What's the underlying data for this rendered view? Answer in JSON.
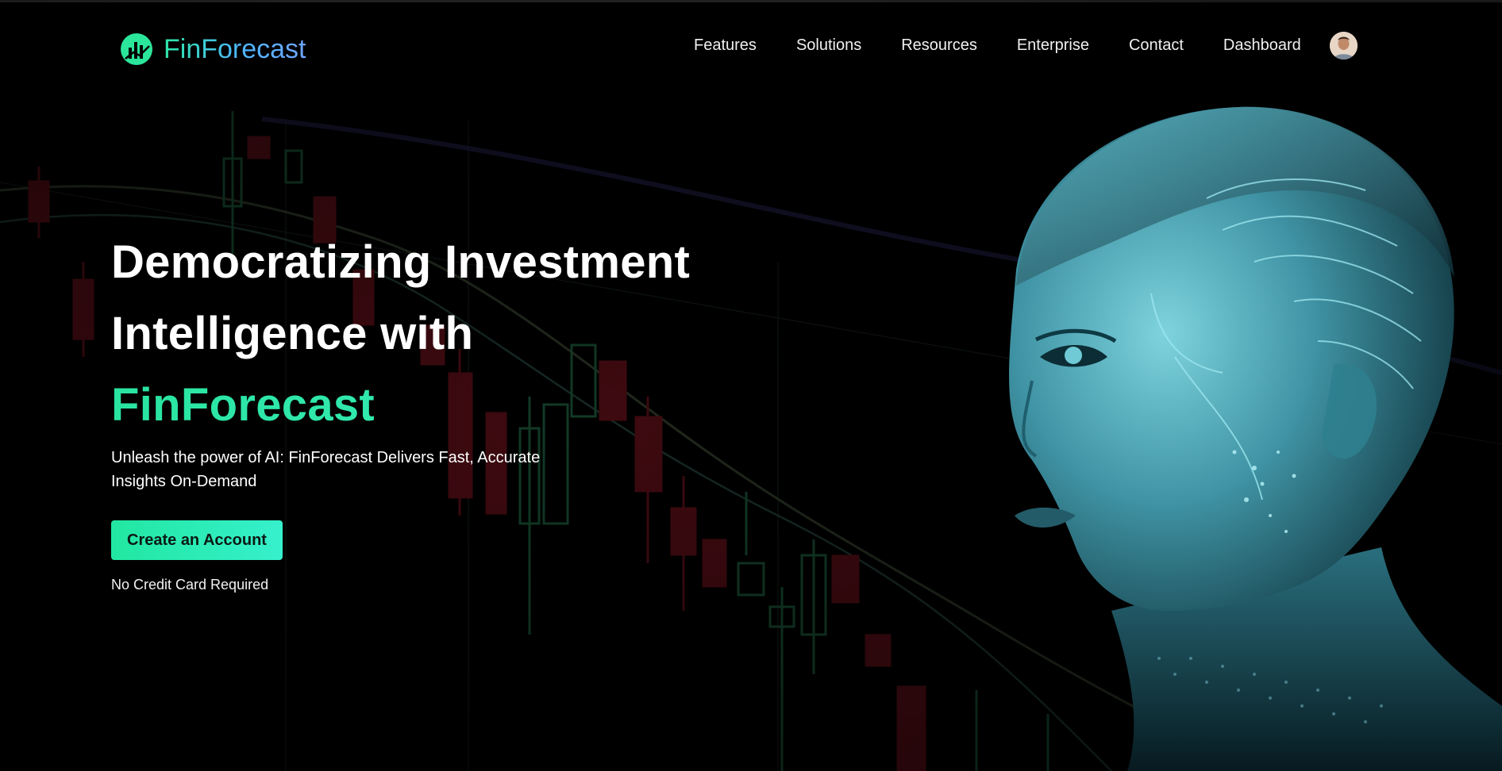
{
  "header": {
    "brand": "FinForecast",
    "nav": [
      {
        "label": "Features"
      },
      {
        "label": "Solutions"
      },
      {
        "label": "Resources"
      },
      {
        "label": "Enterprise"
      },
      {
        "label": "Contact"
      },
      {
        "label": "Dashboard"
      }
    ],
    "avatar_icon": "user-avatar"
  },
  "hero": {
    "title_line1": "Democratizing Investment",
    "title_line2": "Intelligence with",
    "title_brand": "FinForecast",
    "subtitle": "Unleash the power of AI: FinForecast Delivers Fast, Accurate Insights On-Demand",
    "cta_label": "Create an Account",
    "note": "No Credit Card Required"
  },
  "colors": {
    "background": "#000000",
    "accent_green": "#29e4a0",
    "accent_cyan": "#36f0cc",
    "accent_blue": "#4fb6ff",
    "candle_red": "#4a0a0f",
    "candle_green": "#0f3b22",
    "portrait_tone": "#4fb3c4"
  },
  "icons": {
    "logo": "chart-leaf-logo-icon",
    "background": "candlestick-chart-graphic",
    "portrait": "ai-humanoid-portrait-graphic"
  }
}
